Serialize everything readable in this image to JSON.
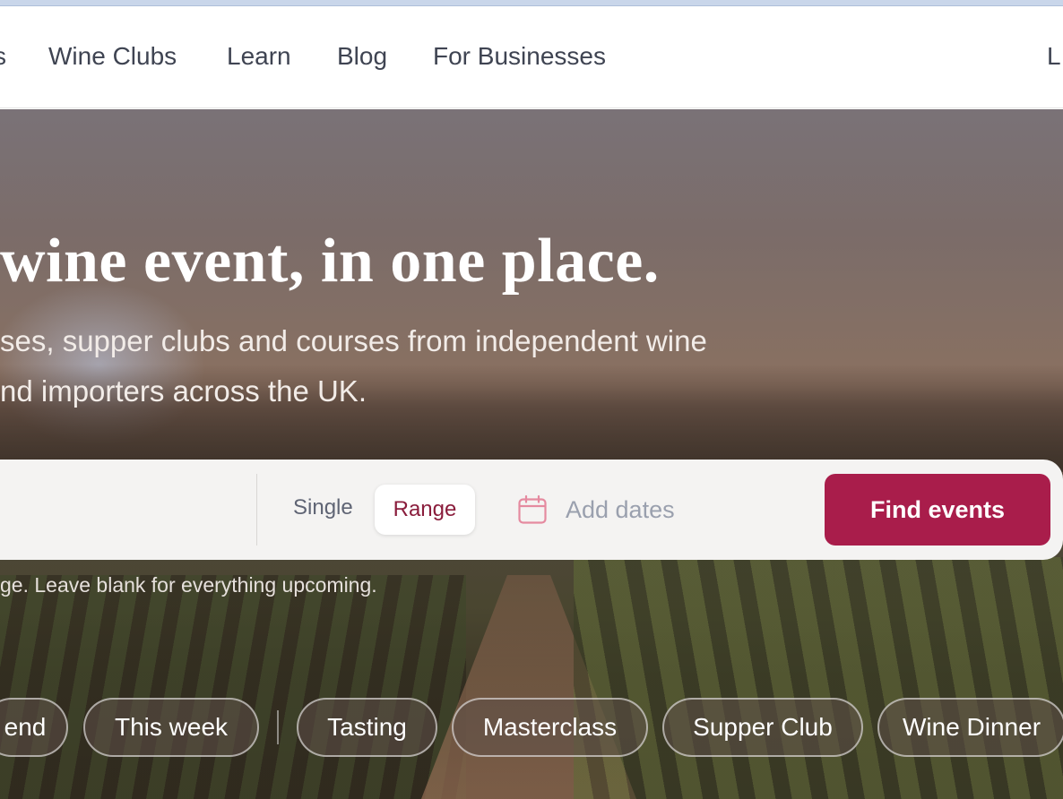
{
  "nav": {
    "partial_left": "s",
    "links": [
      "Wine Clubs",
      "Learn",
      "Blog",
      "For Businesses"
    ],
    "partial_right": "L"
  },
  "hero": {
    "headline": "wine event, in one place.",
    "subline_1": "ses, supper clubs and courses from independent wine",
    "subline_2": "nd importers across the UK."
  },
  "search": {
    "mode_single": "Single",
    "mode_range": "Range",
    "mode_selected": "Range",
    "date_placeholder": "Add dates",
    "submit_label": "Find events",
    "hint": "ge. Leave blank for everything upcoming."
  },
  "chips": [
    "end",
    "This week",
    "Tasting",
    "Masterclass",
    "Supper Club",
    "Wine Dinner"
  ],
  "colors": {
    "brand": "#a91d4b",
    "range_text": "#8a1d3c",
    "calendar_icon": "#e58aa0"
  }
}
